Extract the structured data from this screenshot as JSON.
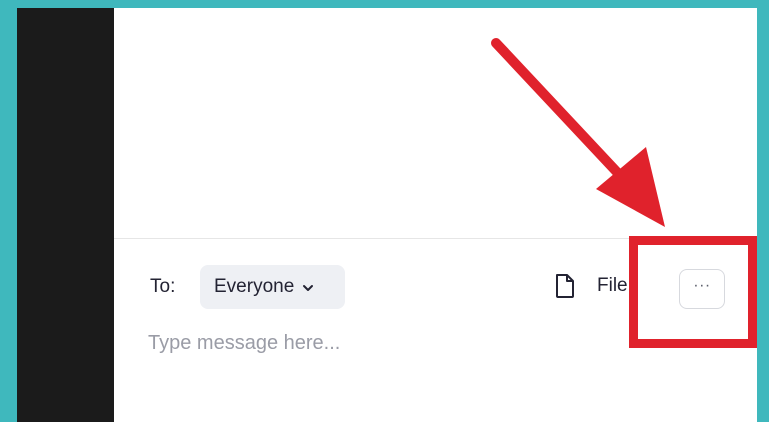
{
  "chat": {
    "to_label": "To:",
    "recipient": "Everyone",
    "file_label": "File",
    "more_label": "···",
    "input_placeholder": "Type message here...",
    "input_value": ""
  },
  "annotation": {
    "color": "#e0222c",
    "target": "more-options-button"
  },
  "colors": {
    "background_frame": "#3fb8bd",
    "dark_strip": "#1b1b1b",
    "panel": "#ffffff",
    "pill": "#eef0f4"
  }
}
